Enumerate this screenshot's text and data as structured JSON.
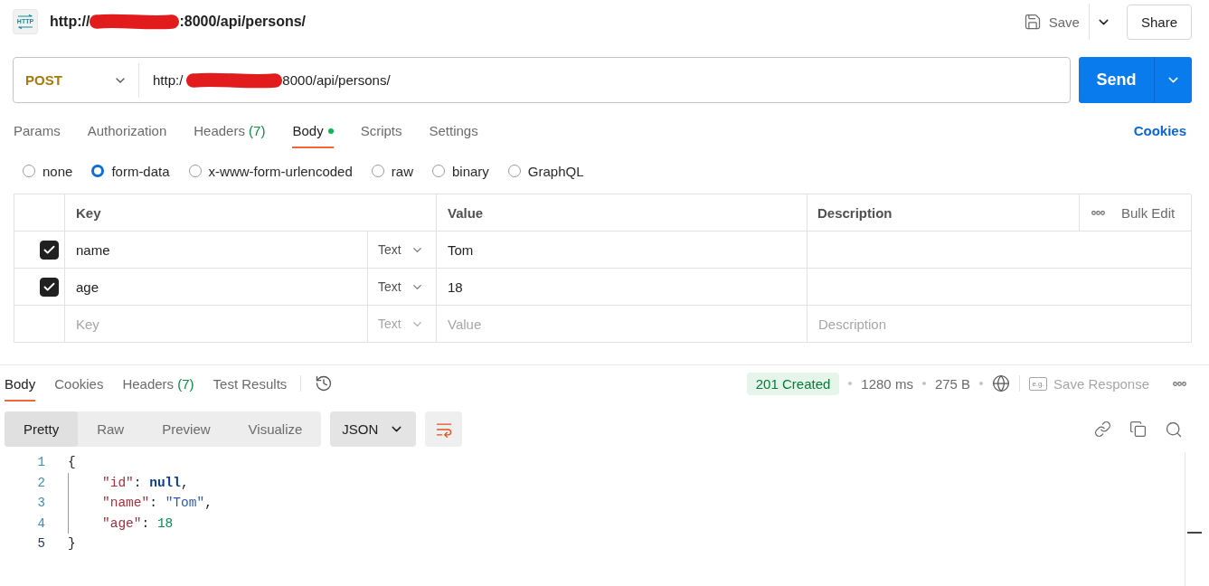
{
  "request": {
    "icon_label": "HTTP",
    "title_start": "http://",
    "title_end": ":8000/api/persons/",
    "redacted": true,
    "save": "Save",
    "share": "Share"
  },
  "url_bar": {
    "method": "POST",
    "url_start": "http:/",
    "url_end": "8000/api/persons/",
    "redacted": true,
    "send": "Send"
  },
  "request_tabs": [
    {
      "label": "Params",
      "selected": false,
      "modified": false
    },
    {
      "label": "Authorization",
      "selected": false,
      "modified": false
    },
    {
      "label": "Headers",
      "count": "(7)",
      "selected": false,
      "modified": false
    },
    {
      "label": "Body",
      "selected": true,
      "modified": true
    },
    {
      "label": "Scripts",
      "selected": false,
      "modified": false
    },
    {
      "label": "Settings",
      "selected": false,
      "modified": false
    }
  ],
  "cookies_link": "Cookies",
  "body_types": [
    {
      "label": "none",
      "selected": false
    },
    {
      "label": "form-data",
      "selected": true
    },
    {
      "label": "x-www-form-urlencoded",
      "selected": false
    },
    {
      "label": "raw",
      "selected": false
    },
    {
      "label": "binary",
      "selected": false
    },
    {
      "label": "GraphQL",
      "selected": false
    }
  ],
  "params_table": {
    "columns": [
      "Key",
      "Value",
      "Description"
    ],
    "bulk_edit": "Bulk Edit",
    "rows": [
      {
        "checked": true,
        "key": "name",
        "type": "Text",
        "value": "Tom"
      },
      {
        "checked": true,
        "key": "age",
        "type": "Text",
        "value": "18"
      }
    ],
    "new_row": {
      "key": {
        "placeholder": "Key"
      },
      "type": "Text",
      "type_disabled": true,
      "value": {
        "placeholder": "Value"
      },
      "description": {
        "placeholder": "Description"
      }
    }
  },
  "response": {
    "tabs": [
      {
        "label": "Body",
        "selected": true
      },
      {
        "label": "Cookies",
        "selected": false
      },
      {
        "label": "Headers",
        "count": "(7)",
        "selected": false
      },
      {
        "label": "Test Results",
        "selected": false
      }
    ],
    "status": "201 Created",
    "time": "1280 ms",
    "size": "275 B",
    "example_label": "e.g.",
    "save_response": "Save Response",
    "view_modes": [
      {
        "label": "Pretty",
        "selected": true
      },
      {
        "label": "Raw",
        "selected": false
      },
      {
        "label": "Preview",
        "selected": false
      },
      {
        "label": "Visualize",
        "selected": false
      }
    ],
    "format": "JSON",
    "code_lines": [
      {
        "number": "1",
        "active": false,
        "indented": false,
        "tokens": [
          {
            "kind": "punct",
            "text": "{"
          }
        ]
      },
      {
        "number": "2",
        "active": false,
        "indented": true,
        "tokens": [
          {
            "kind": "key",
            "text": "\"id\""
          },
          {
            "kind": "punct",
            "text": ": "
          },
          {
            "kind": "keyword",
            "text": "null"
          },
          {
            "kind": "punct",
            "text": ","
          }
        ]
      },
      {
        "number": "3",
        "active": false,
        "indented": true,
        "tokens": [
          {
            "kind": "key",
            "text": "\"name\""
          },
          {
            "kind": "punct",
            "text": ": "
          },
          {
            "kind": "string",
            "text": "\"Tom\""
          },
          {
            "kind": "punct",
            "text": ","
          }
        ]
      },
      {
        "number": "4",
        "active": false,
        "indented": true,
        "tokens": [
          {
            "kind": "key",
            "text": "\"age\""
          },
          {
            "kind": "punct",
            "text": ": "
          },
          {
            "kind": "number",
            "text": "18"
          }
        ]
      },
      {
        "number": "5",
        "active": true,
        "indented": false,
        "tokens": [
          {
            "kind": "punct",
            "text": "}"
          }
        ]
      }
    ]
  }
}
